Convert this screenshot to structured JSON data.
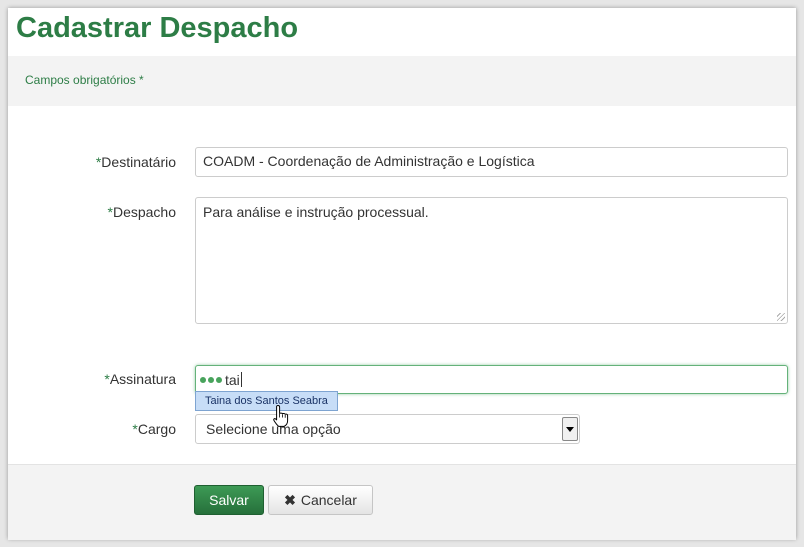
{
  "page": {
    "title": "Cadastrar Despacho"
  },
  "required_note": "Campos obrigatórios *",
  "form": {
    "destinatario": {
      "label": "Destinatário",
      "value": "COADM - Coordenação de Administração e Logística"
    },
    "despacho": {
      "label": "Despacho",
      "value": "Para análise e instrução processual."
    },
    "assinatura": {
      "label": "Assinatura",
      "value": "tai",
      "suggestion": "Taina dos Santos Seabra"
    },
    "cargo": {
      "label": "Cargo",
      "selected": "Selecione uma opção"
    },
    "required_mark": "*"
  },
  "buttons": {
    "save": "Salvar",
    "cancel": "Cancelar"
  },
  "icons": {
    "loading": "loading-dots-icon",
    "cancel": "close-icon",
    "pointer": "hand-cursor-icon",
    "select": "chevron-down-icon"
  },
  "colors": {
    "accent": "#2d7d46",
    "suggestion_bg": "#c7ddf7"
  }
}
